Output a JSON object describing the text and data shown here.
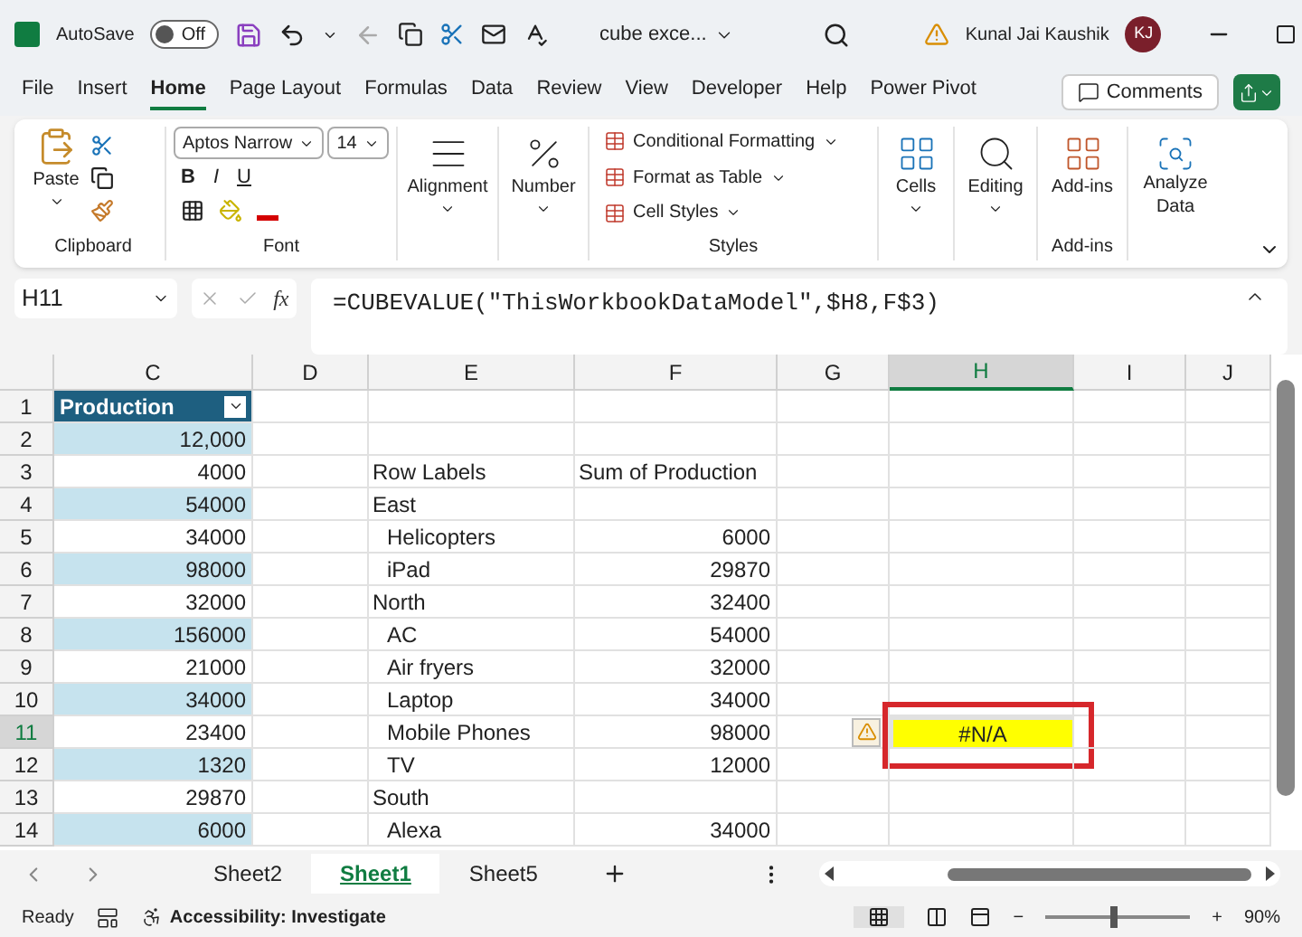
{
  "title_bar": {
    "autosave_label": "AutoSave",
    "autosave_on": false,
    "autosave_state": "Off",
    "file_name": "cube exce...",
    "user_name": "Kunal Jai Kaushik",
    "user_initials": "KJ"
  },
  "menu_tabs": [
    {
      "label": "File",
      "selected": false
    },
    {
      "label": "Insert",
      "selected": false
    },
    {
      "label": "Home",
      "selected": true
    },
    {
      "label": "Page Layout",
      "selected": false
    },
    {
      "label": "Formulas",
      "selected": false
    },
    {
      "label": "Data",
      "selected": false
    },
    {
      "label": "Review",
      "selected": false
    },
    {
      "label": "View",
      "selected": false
    },
    {
      "label": "Developer",
      "selected": false
    },
    {
      "label": "Help",
      "selected": false
    },
    {
      "label": "Power Pivot",
      "selected": false
    }
  ],
  "comments_button": "Comments",
  "ribbon": {
    "paste": "Paste",
    "clipboard_label": "Clipboard",
    "font_name": "Aptos Narrow",
    "font_size": "14",
    "bold": "B",
    "italic": "I",
    "underline": "U",
    "font_label": "Font",
    "alignment": "Alignment",
    "number": "Number",
    "styles": [
      "Conditional Formatting",
      "Format as Table",
      "Cell Styles"
    ],
    "styles_label": "Styles",
    "cells": "Cells",
    "editing": "Editing",
    "addins": "Add-ins",
    "addins_label": "Add-ins",
    "analyze": "Analyze Data"
  },
  "formula_bar": {
    "name_box": "H11",
    "function_symbol": "fx",
    "formula": "=CUBEVALUE(\"ThisWorkbookDataModel\",$H8,F$3)"
  },
  "columns": [
    {
      "label": "C",
      "selected": false
    },
    {
      "label": "D",
      "selected": false
    },
    {
      "label": "E",
      "selected": false
    },
    {
      "label": "F",
      "selected": false
    },
    {
      "label": "G",
      "selected": false
    },
    {
      "label": "H",
      "selected": true
    },
    {
      "label": "I",
      "selected": false
    },
    {
      "label": "J",
      "selected": false
    }
  ],
  "rows": [
    {
      "number": "1",
      "selected": false,
      "c": "Production",
      "warning": false
    },
    {
      "number": "2",
      "selected": false,
      "c": "12,000",
      "warning": false
    },
    {
      "number": "3",
      "selected": false,
      "c": "4000",
      "label": {
        "text": "Row Labels",
        "kind": "heading"
      },
      "f": "Sum of Production",
      "warning": false
    },
    {
      "number": "4",
      "selected": false,
      "c": "54000",
      "label": {
        "text": "East",
        "kind": "group"
      },
      "warning": false
    },
    {
      "number": "5",
      "selected": false,
      "c": "34000",
      "label": {
        "text": "Helicopters",
        "kind": "item"
      },
      "f": "6000",
      "warning": false
    },
    {
      "number": "6",
      "selected": false,
      "c": "98000",
      "label": {
        "text": "iPad",
        "kind": "item"
      },
      "f": "29870",
      "warning": false
    },
    {
      "number": "7",
      "selected": false,
      "c": "32000",
      "label": {
        "text": "North",
        "kind": "group"
      },
      "f": "32400",
      "warning": false
    },
    {
      "number": "8",
      "selected": false,
      "c": "156000",
      "label": {
        "text": "AC",
        "kind": "item"
      },
      "f": "54000",
      "warning": false
    },
    {
      "number": "9",
      "selected": false,
      "c": "21000",
      "label": {
        "text": "Air fryers",
        "kind": "item"
      },
      "f": "32000",
      "warning": false
    },
    {
      "number": "10",
      "selected": false,
      "c": "34000",
      "label": {
        "text": "Laptop",
        "kind": "item"
      },
      "f": "34000",
      "warning": false
    },
    {
      "number": "11",
      "selected": true,
      "c": "23400",
      "label": {
        "text": "Mobile Phones",
        "kind": "item"
      },
      "f": "98000",
      "h": "#N/A",
      "warning": true
    },
    {
      "number": "12",
      "selected": false,
      "c": "1320",
      "label": {
        "text": "TV",
        "kind": "item"
      },
      "f": "12000",
      "warning": false
    },
    {
      "number": "13",
      "selected": false,
      "c": "29870",
      "label": {
        "text": "South",
        "kind": "group"
      },
      "warning": false
    },
    {
      "number": "14",
      "selected": false,
      "c": "6000",
      "label": {
        "text": "Alexa",
        "kind": "item"
      },
      "f": "34000",
      "warning": false
    }
  ],
  "sheet_tabs": [
    {
      "label": "Sheet2",
      "selected": false
    },
    {
      "label": "Sheet1",
      "selected": true
    },
    {
      "label": "Sheet5",
      "selected": false
    }
  ],
  "status_bar": {
    "ready": "Ready",
    "accessibility": "Accessibility: Investigate",
    "zoom_out": "−",
    "zoom_in": "+",
    "zoom": "90%",
    "zoom_slider": {
      "level": 0.47
    }
  }
}
